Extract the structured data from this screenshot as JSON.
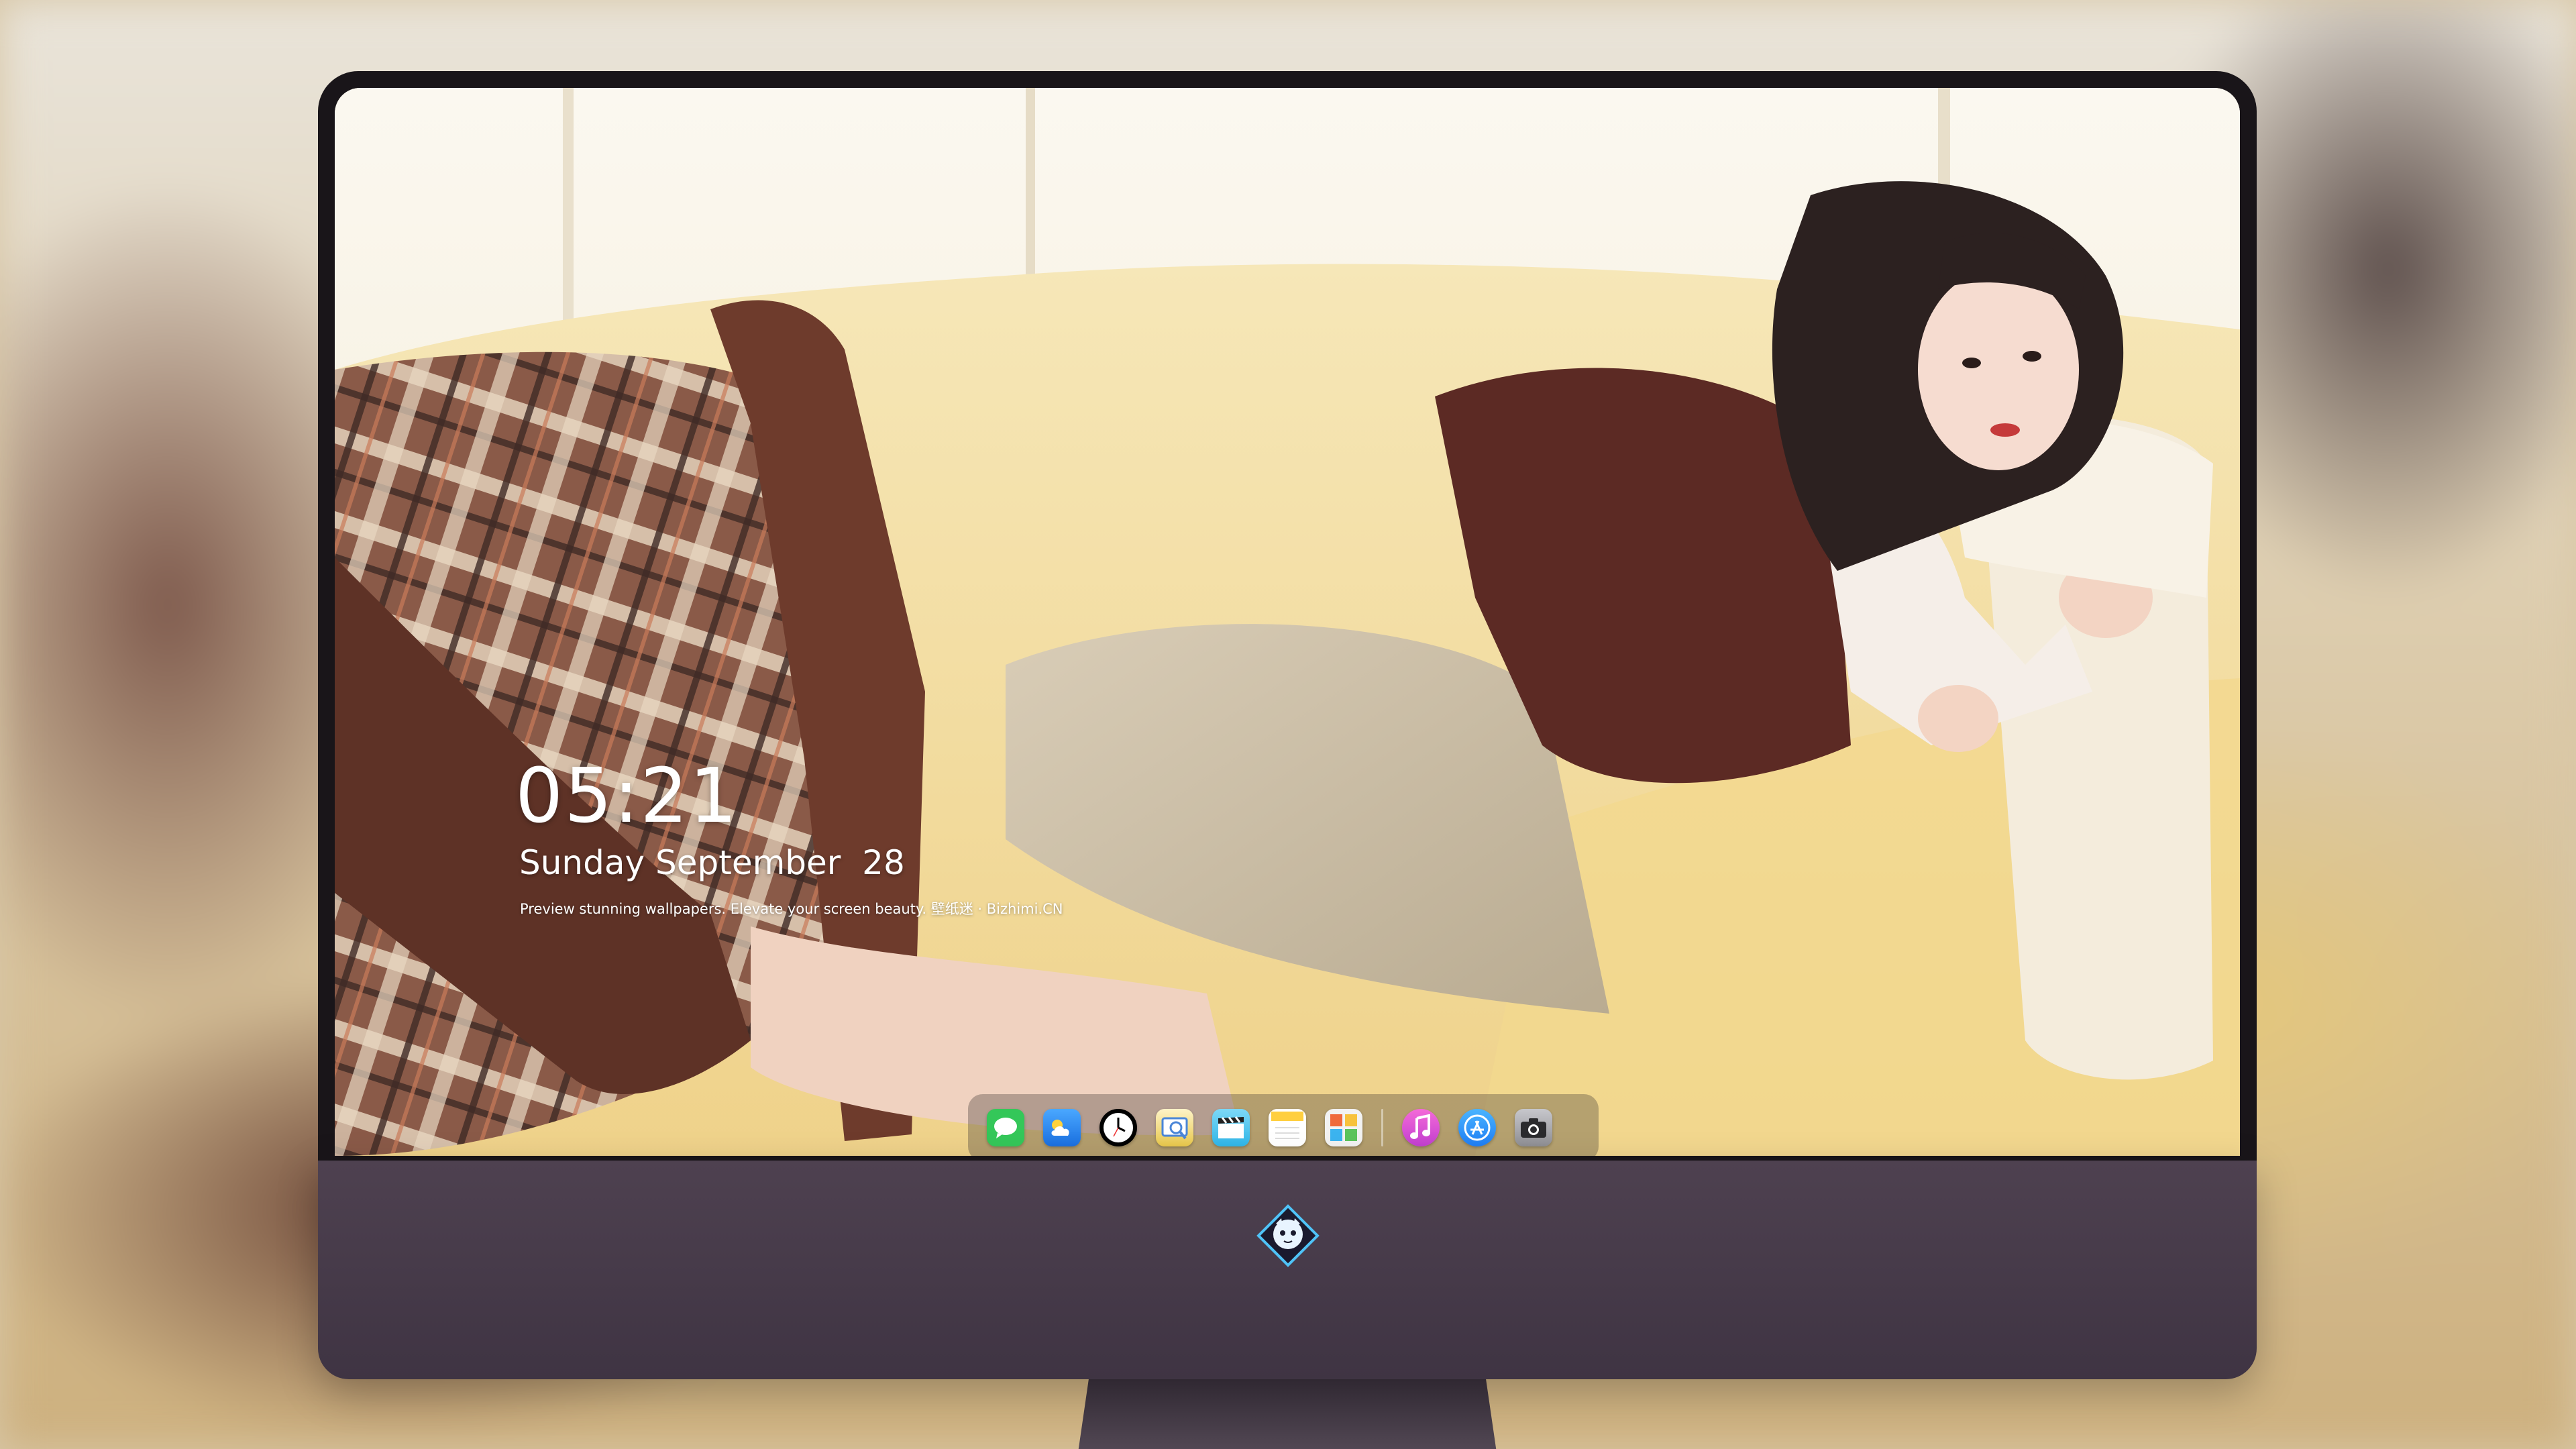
{
  "lockscreen": {
    "time": "05:21",
    "date": "Sunday September  28",
    "tagline": "Preview stunning wallpapers. Elevate your screen beauty. 壁纸迷 · Bizhimi.CN"
  },
  "dock": {
    "apps": [
      {
        "icon": "messages-icon",
        "color": "#34c759"
      },
      {
        "icon": "weather-icon",
        "color": "#1e90ff"
      },
      {
        "icon": "clock-icon",
        "color": "#000000"
      },
      {
        "icon": "preview-icon",
        "color": "#e9c84a"
      },
      {
        "icon": "video-clapper-icon",
        "color": "#2fb6e8"
      },
      {
        "icon": "notes-icon",
        "color": "#ffd75a"
      },
      {
        "icon": "photo-gallery-icon",
        "color": "#f2f2f2"
      },
      {
        "icon": "music-icon",
        "color": "#e34fd0"
      },
      {
        "icon": "app-store-icon",
        "color": "#1f8ef5"
      },
      {
        "icon": "camera-icon",
        "color": "#8e8e93"
      }
    ]
  },
  "monitor": {
    "logo_icon": "dragon-mascot-logo"
  }
}
